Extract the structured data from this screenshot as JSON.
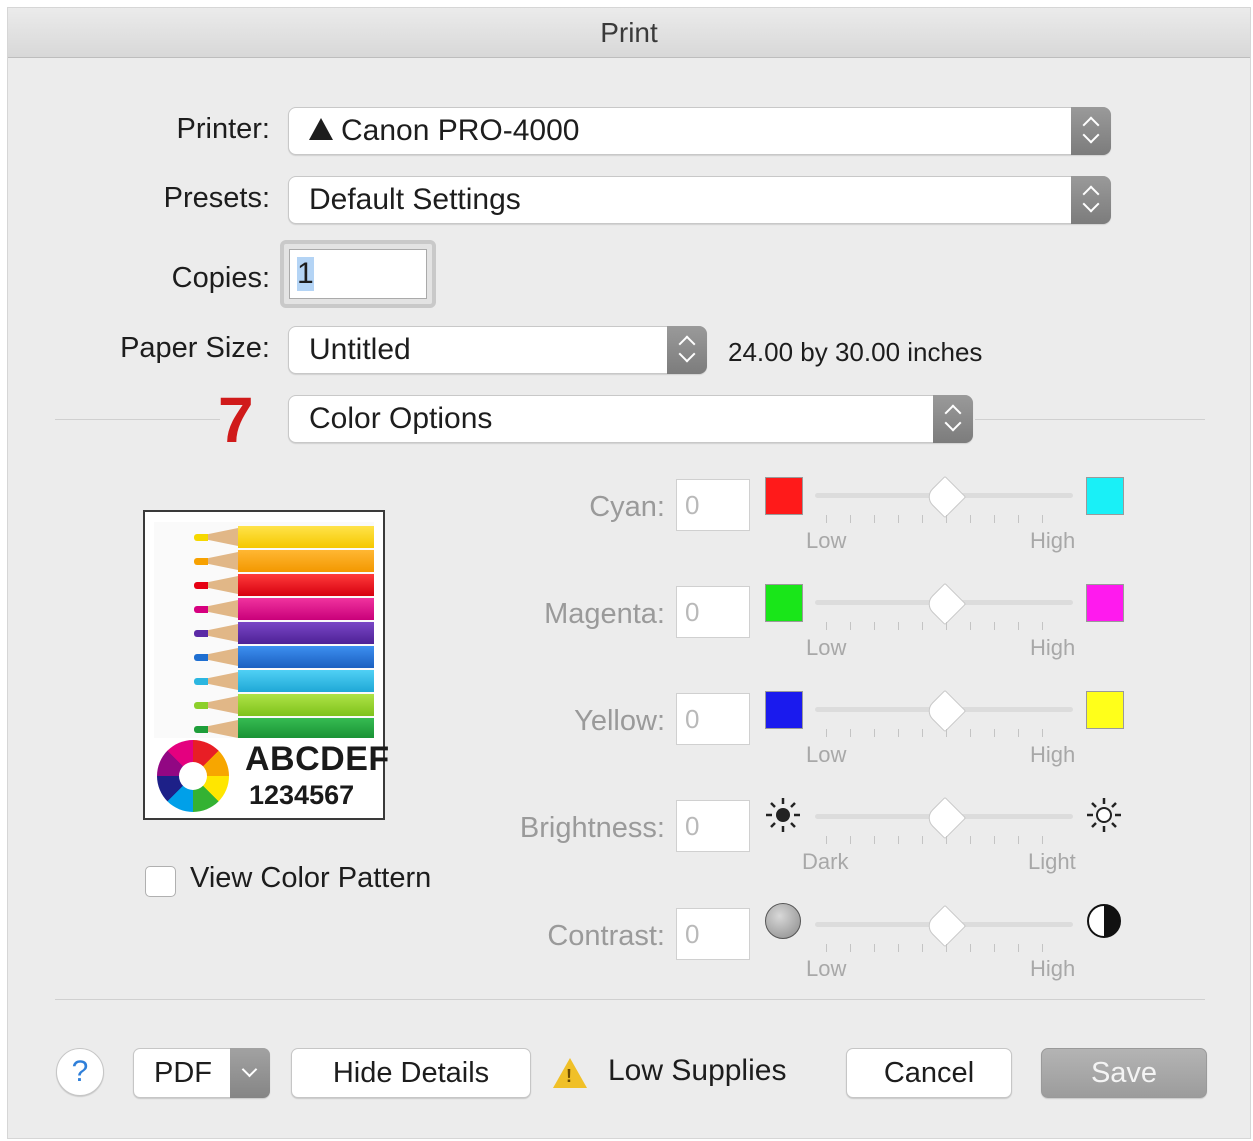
{
  "window": {
    "title": "Print"
  },
  "printer": {
    "label": "Printer:",
    "value": "Canon PRO-4000",
    "icon": "warning-triangle-icon"
  },
  "presets": {
    "label": "Presets:",
    "value": "Default Settings"
  },
  "copies": {
    "label": "Copies:",
    "value": "1"
  },
  "paper_size": {
    "label": "Paper Size:",
    "value": "Untitled",
    "dimensions": "24.00 by 30.00 inches"
  },
  "step_marker": "7",
  "panel_select": {
    "value": "Color Options"
  },
  "preview": {
    "line1": "ABCDEF",
    "line2": "1234567"
  },
  "view_color_pattern": {
    "label": "View Color Pattern",
    "checked": false
  },
  "adjustments": [
    {
      "name": "cyan",
      "label": "Cyan:",
      "value": "0",
      "low_label": "Low",
      "high_label": "High",
      "low_color": "#ff1a1a",
      "high_color": "#19f0f7",
      "level": 0.5
    },
    {
      "name": "magenta",
      "label": "Magenta:",
      "value": "0",
      "low_label": "Low",
      "high_label": "High",
      "low_color": "#19e619",
      "high_color": "#ff1aee",
      "level": 0.5
    },
    {
      "name": "yellow",
      "label": "Yellow:",
      "value": "0",
      "low_label": "Low",
      "high_label": "High",
      "low_color": "#1a1aee",
      "high_color": "#ffff1a",
      "level": 0.5
    },
    {
      "name": "brightness",
      "label": "Brightness:",
      "value": "0",
      "low_label": "Dark",
      "high_label": "Light",
      "low_icon": "sun-dark-icon",
      "high_icon": "sun-light-icon",
      "level": 0.5
    },
    {
      "name": "contrast",
      "label": "Contrast:",
      "value": "0",
      "low_label": "Low",
      "high_label": "High",
      "low_icon": "contrast-low-icon",
      "high_icon": "contrast-high-icon",
      "level": 0.5
    }
  ],
  "footer": {
    "help": "?",
    "pdf": "PDF",
    "hide_details": "Hide Details",
    "low_supplies": "Low Supplies",
    "cancel": "Cancel",
    "save": "Save"
  }
}
